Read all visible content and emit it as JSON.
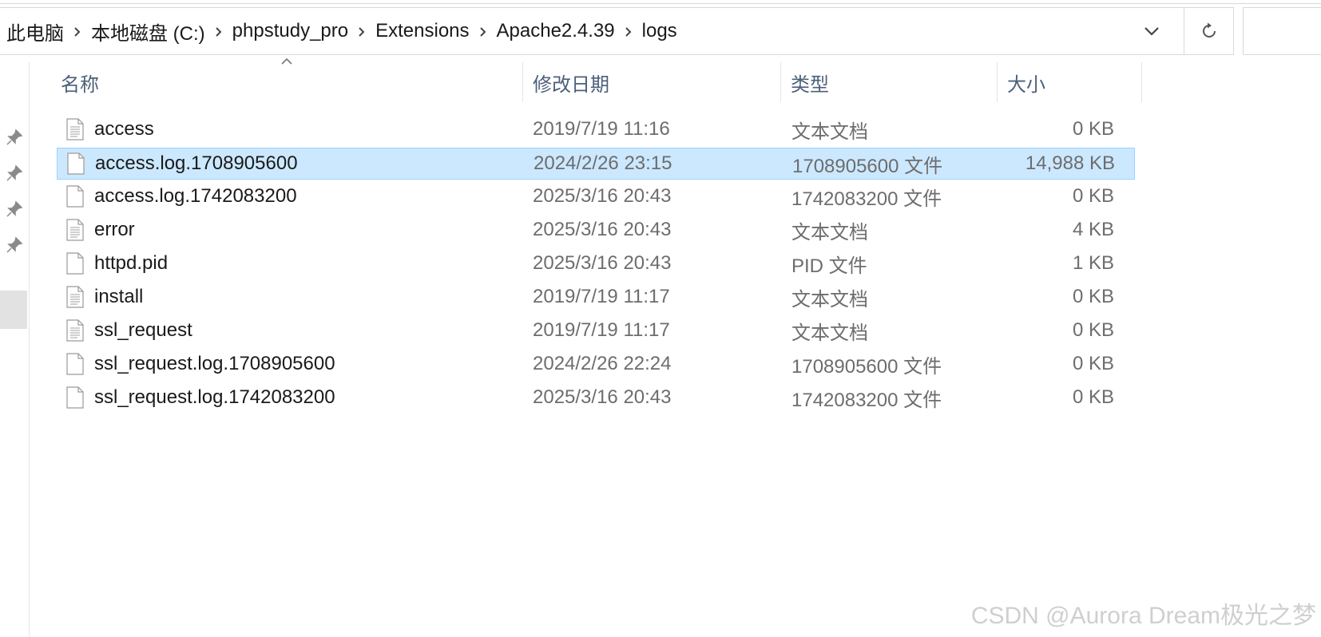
{
  "address_bar": {
    "breadcrumbs": [
      "此电脑",
      "本地磁盘 (C:)",
      "phpstudy_pro",
      "Extensions",
      "Apache2.4.39",
      "logs"
    ]
  },
  "columns": {
    "name": "名称",
    "date": "修改日期",
    "type": "类型",
    "size": "大小"
  },
  "sort": {
    "column": "name",
    "direction": "ascending"
  },
  "files": [
    {
      "name": "access",
      "date": "2019/7/19 11:16",
      "type": "文本文档",
      "size": "0 KB",
      "icon": "text-document-icon",
      "selected": false
    },
    {
      "name": "access.log.1708905600",
      "date": "2024/2/26 23:15",
      "type": "1708905600 文件",
      "size": "14,988 KB",
      "icon": "blank-file-icon",
      "selected": true
    },
    {
      "name": "access.log.1742083200",
      "date": "2025/3/16 20:43",
      "type": "1742083200 文件",
      "size": "0 KB",
      "icon": "blank-file-icon",
      "selected": false
    },
    {
      "name": "error",
      "date": "2025/3/16 20:43",
      "type": "文本文档",
      "size": "4 KB",
      "icon": "text-document-icon",
      "selected": false
    },
    {
      "name": "httpd.pid",
      "date": "2025/3/16 20:43",
      "type": "PID 文件",
      "size": "1 KB",
      "icon": "blank-file-icon",
      "selected": false
    },
    {
      "name": "install",
      "date": "2019/7/19 11:17",
      "type": "文本文档",
      "size": "0 KB",
      "icon": "text-document-icon",
      "selected": false
    },
    {
      "name": "ssl_request",
      "date": "2019/7/19 11:17",
      "type": "文本文档",
      "size": "0 KB",
      "icon": "text-document-icon",
      "selected": false
    },
    {
      "name": "ssl_request.log.1708905600",
      "date": "2024/2/26 22:24",
      "type": "1708905600 文件",
      "size": "0 KB",
      "icon": "blank-file-icon",
      "selected": false
    },
    {
      "name": "ssl_request.log.1742083200",
      "date": "2025/3/16 20:43",
      "type": "1742083200 文件",
      "size": "0 KB",
      "icon": "blank-file-icon",
      "selected": false
    }
  ],
  "watermark": "CSDN @Aurora Dream极光之梦",
  "colors": {
    "selection_bg": "#cce8ff",
    "selection_border": "#99d1ff",
    "header_text": "#4c607a",
    "secondary_text": "#6d6d6d"
  }
}
